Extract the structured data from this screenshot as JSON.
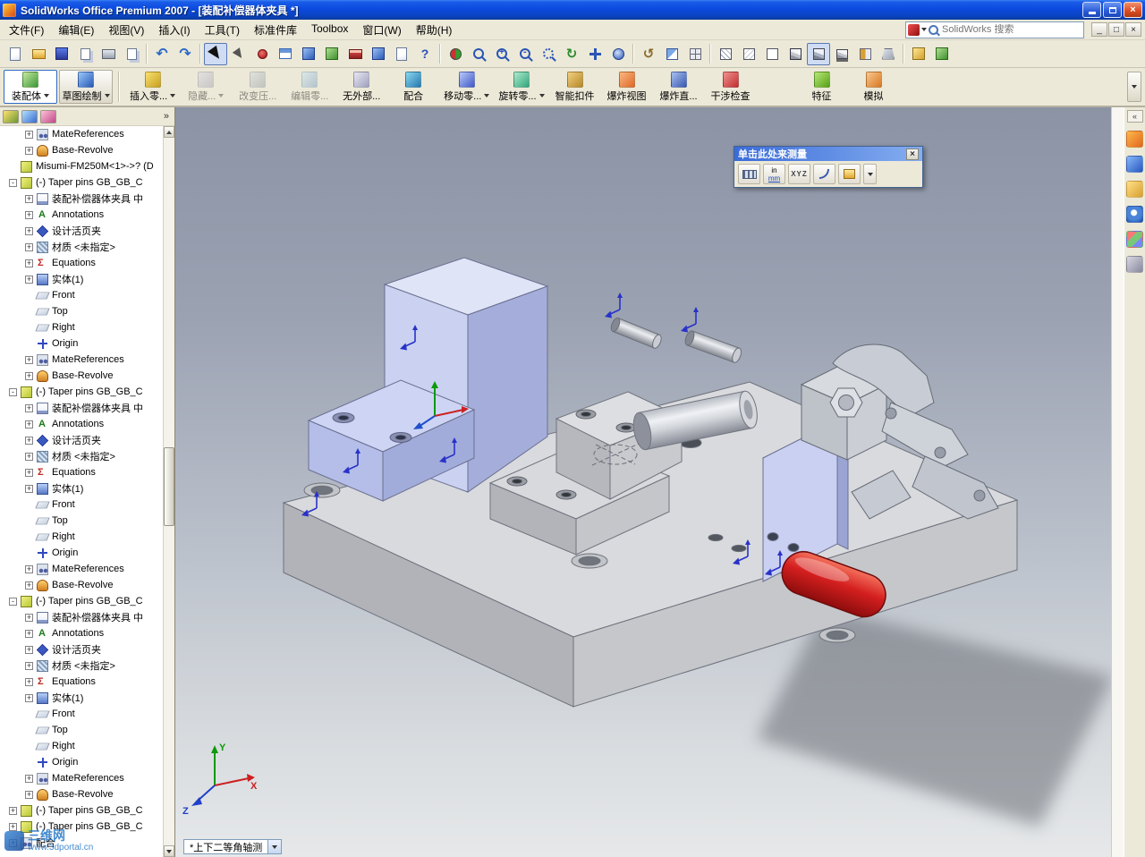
{
  "titlebar": {
    "title": "SolidWorks Office Premium 2007 - [装配补偿器体夹具 *]",
    "close_glyph": "×"
  },
  "menubar": {
    "items": [
      "文件(F)",
      "编辑(E)",
      "视图(V)",
      "插入(I)",
      "工具(T)",
      "标准件库",
      "Toolbox",
      "窗口(W)",
      "帮助(H)"
    ],
    "search": {
      "placeholder": "SolidWorks 搜索"
    },
    "mdi": {
      "minimize": "_",
      "restore": "□",
      "close": "×"
    }
  },
  "toolbar": {
    "icons": [
      {
        "n": "new-document-icon",
        "c": "i-page"
      },
      {
        "n": "open-icon",
        "c": "i-open"
      },
      {
        "n": "save-icon",
        "c": "i-save"
      },
      {
        "n": "print-preview-icon",
        "c": "i-pages"
      },
      {
        "n": "print-icon",
        "c": "i-print"
      },
      {
        "n": "properties-icon",
        "c": "i-pages"
      },
      {
        "sep": true
      },
      {
        "n": "undo-icon",
        "c": "i-undo"
      },
      {
        "n": "redo-icon",
        "c": "i-redo"
      },
      {
        "sep": true
      },
      {
        "n": "select-icon",
        "c": "i-cursor",
        "p": "pressed"
      },
      {
        "n": "select-filter-icon",
        "c": "i-cursor2"
      },
      {
        "n": "record-macro-icon",
        "c": "i-red"
      },
      {
        "n": "design-table-icon",
        "c": "i-table"
      },
      {
        "n": "dimension-icon",
        "c": "c-blue"
      },
      {
        "n": "annotation-icon",
        "c": "c-green"
      },
      {
        "n": "toolbox-icon",
        "c": "i-toolbox"
      },
      {
        "n": "chart-icon",
        "c": "c-blue"
      },
      {
        "n": "document-icon",
        "c": "i-page"
      },
      {
        "n": "help-icon",
        "c": "i-help"
      },
      {
        "sep": true
      },
      {
        "n": "rebuild-icon",
        "c": "i-rebuild"
      },
      {
        "n": "zoom-window-icon",
        "c": "i-zoomw"
      },
      {
        "n": "zoom-in-icon",
        "c": "i-zoomin"
      },
      {
        "n": "zoom-out-icon",
        "c": "i-zoomout"
      },
      {
        "n": "zoom-fit-icon",
        "c": "i-zoomfit"
      },
      {
        "n": "rotate-view-icon",
        "c": "i-rotate"
      },
      {
        "n": "pan-icon",
        "c": "i-pan"
      },
      {
        "n": "3d-drag-icon",
        "c": "i-3d"
      },
      {
        "sep": true
      },
      {
        "n": "previous-view-icon",
        "c": "i-prev"
      },
      {
        "n": "section-view-icon",
        "c": "i-sectionv"
      },
      {
        "n": "view-orientation-icon",
        "c": "i-orient"
      },
      {
        "sep": true
      },
      {
        "n": "wireframe-icon",
        "c": "i-cube-wf"
      },
      {
        "n": "hidden-lines-visible-icon",
        "c": "i-cube-hl"
      },
      {
        "n": "hidden-lines-removed-icon",
        "c": "i-cube-hr"
      },
      {
        "n": "shaded-with-edges-icon",
        "c": "i-cube-se"
      },
      {
        "n": "shaded-icon",
        "c": "i-cube-sh",
        "p": "pressed"
      },
      {
        "n": "shadows-icon",
        "c": "i-cube-shadow"
      },
      {
        "n": "section-icon",
        "c": "i-section"
      },
      {
        "n": "perspective-icon",
        "c": "i-persp"
      },
      {
        "sep": true
      },
      {
        "n": "edit-component-icon",
        "c": "c-yellow"
      },
      {
        "n": "lightweight-icon",
        "c": "c-green"
      }
    ]
  },
  "cmdmgr": {
    "tabs": [
      {
        "label": "装配体",
        "c": "ico-asm",
        "a": "active"
      },
      {
        "label": "草图绘制",
        "c": "ico-sketch"
      }
    ],
    "buttons": [
      {
        "label": "插入零...",
        "c": "ico-insert",
        "dd": true
      },
      {
        "label": "隐藏...",
        "c": "ico-hide",
        "dcls": "disabled",
        "dd": true
      },
      {
        "label": "改变压...",
        "c": "ico-suppress",
        "dcls": "disabled"
      },
      {
        "label": "编辑零...",
        "c": "ico-editpart",
        "dcls": "disabled"
      },
      {
        "label": "无外部...",
        "c": "ico-noext"
      },
      {
        "label": "配合",
        "c": "ico-mate"
      },
      {
        "label": "移动零...",
        "c": "ico-move",
        "dd": true
      },
      {
        "label": "旋转零...",
        "c": "ico-rotate",
        "dd": true
      },
      {
        "label": "智能扣件",
        "c": "ico-fastener"
      },
      {
        "label": "爆炸视图",
        "c": "ico-explode"
      },
      {
        "label": "爆炸直...",
        "c": "ico-explline"
      },
      {
        "label": "干涉检查",
        "c": "ico-interf"
      },
      {
        "label": "特征",
        "c": "ico-features",
        "g": "gap"
      },
      {
        "label": "模拟",
        "c": "ico-sim"
      }
    ]
  },
  "tree": {
    "chevron": "»",
    "rows": [
      {
        "e": "+",
        "i": "t-mate",
        "d": "d2",
        "l": "MateReferences"
      },
      {
        "e": "+",
        "i": "t-rev",
        "d": "d2",
        "l": "Base-Revolve"
      },
      {
        "e": "",
        "i": "t-part",
        "d": "d1",
        "l": "Misumi-FM250M<1>->? (D"
      },
      {
        "e": "-",
        "i": "t-part",
        "d": "d1",
        "l": "(-) Taper pins GB_GB_C"
      },
      {
        "e": "+",
        "i": "t-doc",
        "d": "d2",
        "l": "装配补偿器体夹具 中"
      },
      {
        "e": "+",
        "i": "t-ann",
        "d": "d2",
        "l": "Annotations"
      },
      {
        "e": "+",
        "i": "t-binder",
        "d": "d2",
        "l": "设计活页夹"
      },
      {
        "e": "+",
        "i": "t-mat",
        "d": "d2",
        "l": "材质 <未指定>"
      },
      {
        "e": "+",
        "i": "t-eq",
        "d": "d2",
        "l": "Equations"
      },
      {
        "e": "+",
        "i": "t-solid",
        "d": "d2",
        "l": "实体(1)"
      },
      {
        "e": "",
        "i": "t-plane",
        "d": "d2",
        "l": "Front"
      },
      {
        "e": "",
        "i": "t-plane",
        "d": "d2",
        "l": "Top"
      },
      {
        "e": "",
        "i": "t-plane",
        "d": "d2",
        "l": "Right"
      },
      {
        "e": "",
        "i": "t-origin",
        "d": "d2",
        "l": "Origin"
      },
      {
        "e": "+",
        "i": "t-mate",
        "d": "d2",
        "l": "MateReferences"
      },
      {
        "e": "+",
        "i": "t-rev",
        "d": "d2",
        "l": "Base-Revolve"
      },
      {
        "e": "-",
        "i": "t-part",
        "d": "d1",
        "l": "(-) Taper pins GB_GB_C"
      },
      {
        "e": "+",
        "i": "t-doc",
        "d": "d2",
        "l": "装配补偿器体夹具 中"
      },
      {
        "e": "+",
        "i": "t-ann",
        "d": "d2",
        "l": "Annotations"
      },
      {
        "e": "+",
        "i": "t-binder",
        "d": "d2",
        "l": "设计活页夹"
      },
      {
        "e": "+",
        "i": "t-mat",
        "d": "d2",
        "l": "材质 <未指定>"
      },
      {
        "e": "+",
        "i": "t-eq",
        "d": "d2",
        "l": "Equations"
      },
      {
        "e": "+",
        "i": "t-solid",
        "d": "d2",
        "l": "实体(1)"
      },
      {
        "e": "",
        "i": "t-plane",
        "d": "d2",
        "l": "Front"
      },
      {
        "e": "",
        "i": "t-plane",
        "d": "d2",
        "l": "Top"
      },
      {
        "e": "",
        "i": "t-plane",
        "d": "d2",
        "l": "Right"
      },
      {
        "e": "",
        "i": "t-origin",
        "d": "d2",
        "l": "Origin"
      },
      {
        "e": "+",
        "i": "t-mate",
        "d": "d2",
        "l": "MateReferences"
      },
      {
        "e": "+",
        "i": "t-rev",
        "d": "d2",
        "l": "Base-Revolve"
      },
      {
        "e": "-",
        "i": "t-part",
        "d": "d1",
        "l": "(-) Taper pins GB_GB_C"
      },
      {
        "e": "+",
        "i": "t-doc",
        "d": "d2",
        "l": "装配补偿器体夹具 中"
      },
      {
        "e": "+",
        "i": "t-ann",
        "d": "d2",
        "l": "Annotations"
      },
      {
        "e": "+",
        "i": "t-binder",
        "d": "d2",
        "l": "设计活页夹"
      },
      {
        "e": "+",
        "i": "t-mat",
        "d": "d2",
        "l": "材质 <未指定>"
      },
      {
        "e": "+",
        "i": "t-eq",
        "d": "d2",
        "l": "Equations"
      },
      {
        "e": "+",
        "i": "t-solid",
        "d": "d2",
        "l": "实体(1)"
      },
      {
        "e": "",
        "i": "t-plane",
        "d": "d2",
        "l": "Front"
      },
      {
        "e": "",
        "i": "t-plane",
        "d": "d2",
        "l": "Top"
      },
      {
        "e": "",
        "i": "t-plane",
        "d": "d2",
        "l": "Right"
      },
      {
        "e": "",
        "i": "t-origin",
        "d": "d2",
        "l": "Origin"
      },
      {
        "e": "+",
        "i": "t-mate",
        "d": "d2",
        "l": "MateReferences"
      },
      {
        "e": "+",
        "i": "t-rev",
        "d": "d2",
        "l": "Base-Revolve"
      },
      {
        "e": "+",
        "i": "t-part",
        "d": "d1",
        "l": "(-) Taper pins GB_GB_C"
      },
      {
        "e": "+",
        "i": "t-part",
        "d": "d1",
        "l": "(-) Taper pins GB_GB_C"
      },
      {
        "e": "+",
        "i": "t-mate",
        "d": "d1",
        "l": "配合"
      }
    ]
  },
  "measure": {
    "title": "单击此处来测量",
    "close": "×",
    "in": "in",
    "mm": "mm",
    "xyz": "XYZ"
  },
  "viewport": {
    "view_selector": "*上下二等角轴测",
    "triad": {
      "x": "X",
      "y": "Y",
      "z": "Z"
    }
  },
  "watermark": {
    "line1": "三维网",
    "line2": "www.3dportal.cn"
  },
  "taskpane": {
    "collapse": "«",
    "icons": [
      {
        "n": "solidworks-resources-icon",
        "c": "tp-home"
      },
      {
        "n": "design-library-icon",
        "c": "tp-lib"
      },
      {
        "n": "file-explorer-icon",
        "c": "tp-folder"
      },
      {
        "n": "search-icon",
        "c": "tp-search"
      },
      {
        "n": "view-palette-icon",
        "c": "tp-palette"
      },
      {
        "n": "custom-properties-icon",
        "c": "tp-props"
      }
    ]
  }
}
